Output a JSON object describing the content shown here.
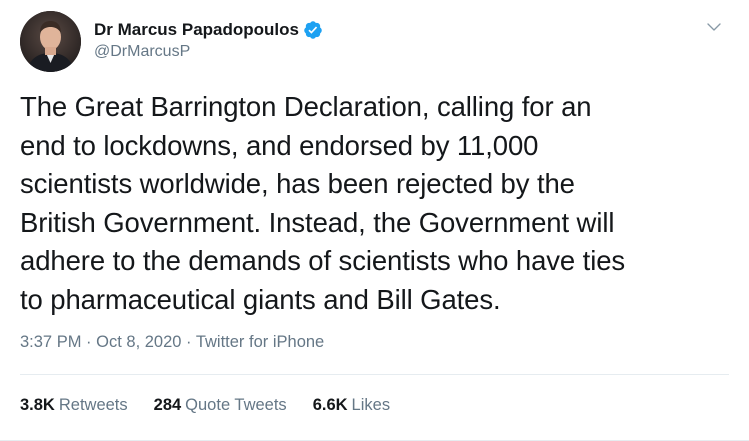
{
  "author": {
    "name": "Dr Marcus Papadopoulos",
    "handle": "@DrMarcusP",
    "verified_icon": "verified-badge-icon",
    "menu_icon": "chevron-down-icon"
  },
  "tweet": {
    "text": "The Great Barrington Declaration, calling for an\nend to lockdowns, and endorsed by 11,000\nscientists worldwide, has been rejected by the\nBritish Government. Instead, the Government will\nadhere to the demands of scientists who have ties\nto pharmaceutical giants and Bill Gates."
  },
  "meta": {
    "time": "3:37 PM",
    "separator": "·",
    "date": "Oct 8, 2020",
    "source": "Twitter for iPhone"
  },
  "stats": {
    "retweets_count": "3.8K",
    "retweets_label": "Retweets",
    "quotes_count": "284",
    "quotes_label": "Quote Tweets",
    "likes_count": "6.6K",
    "likes_label": "Likes"
  },
  "colors": {
    "text": "#14171a",
    "secondary": "#657786",
    "verified": "#1da1f2",
    "divider": "#e6ecf0"
  }
}
